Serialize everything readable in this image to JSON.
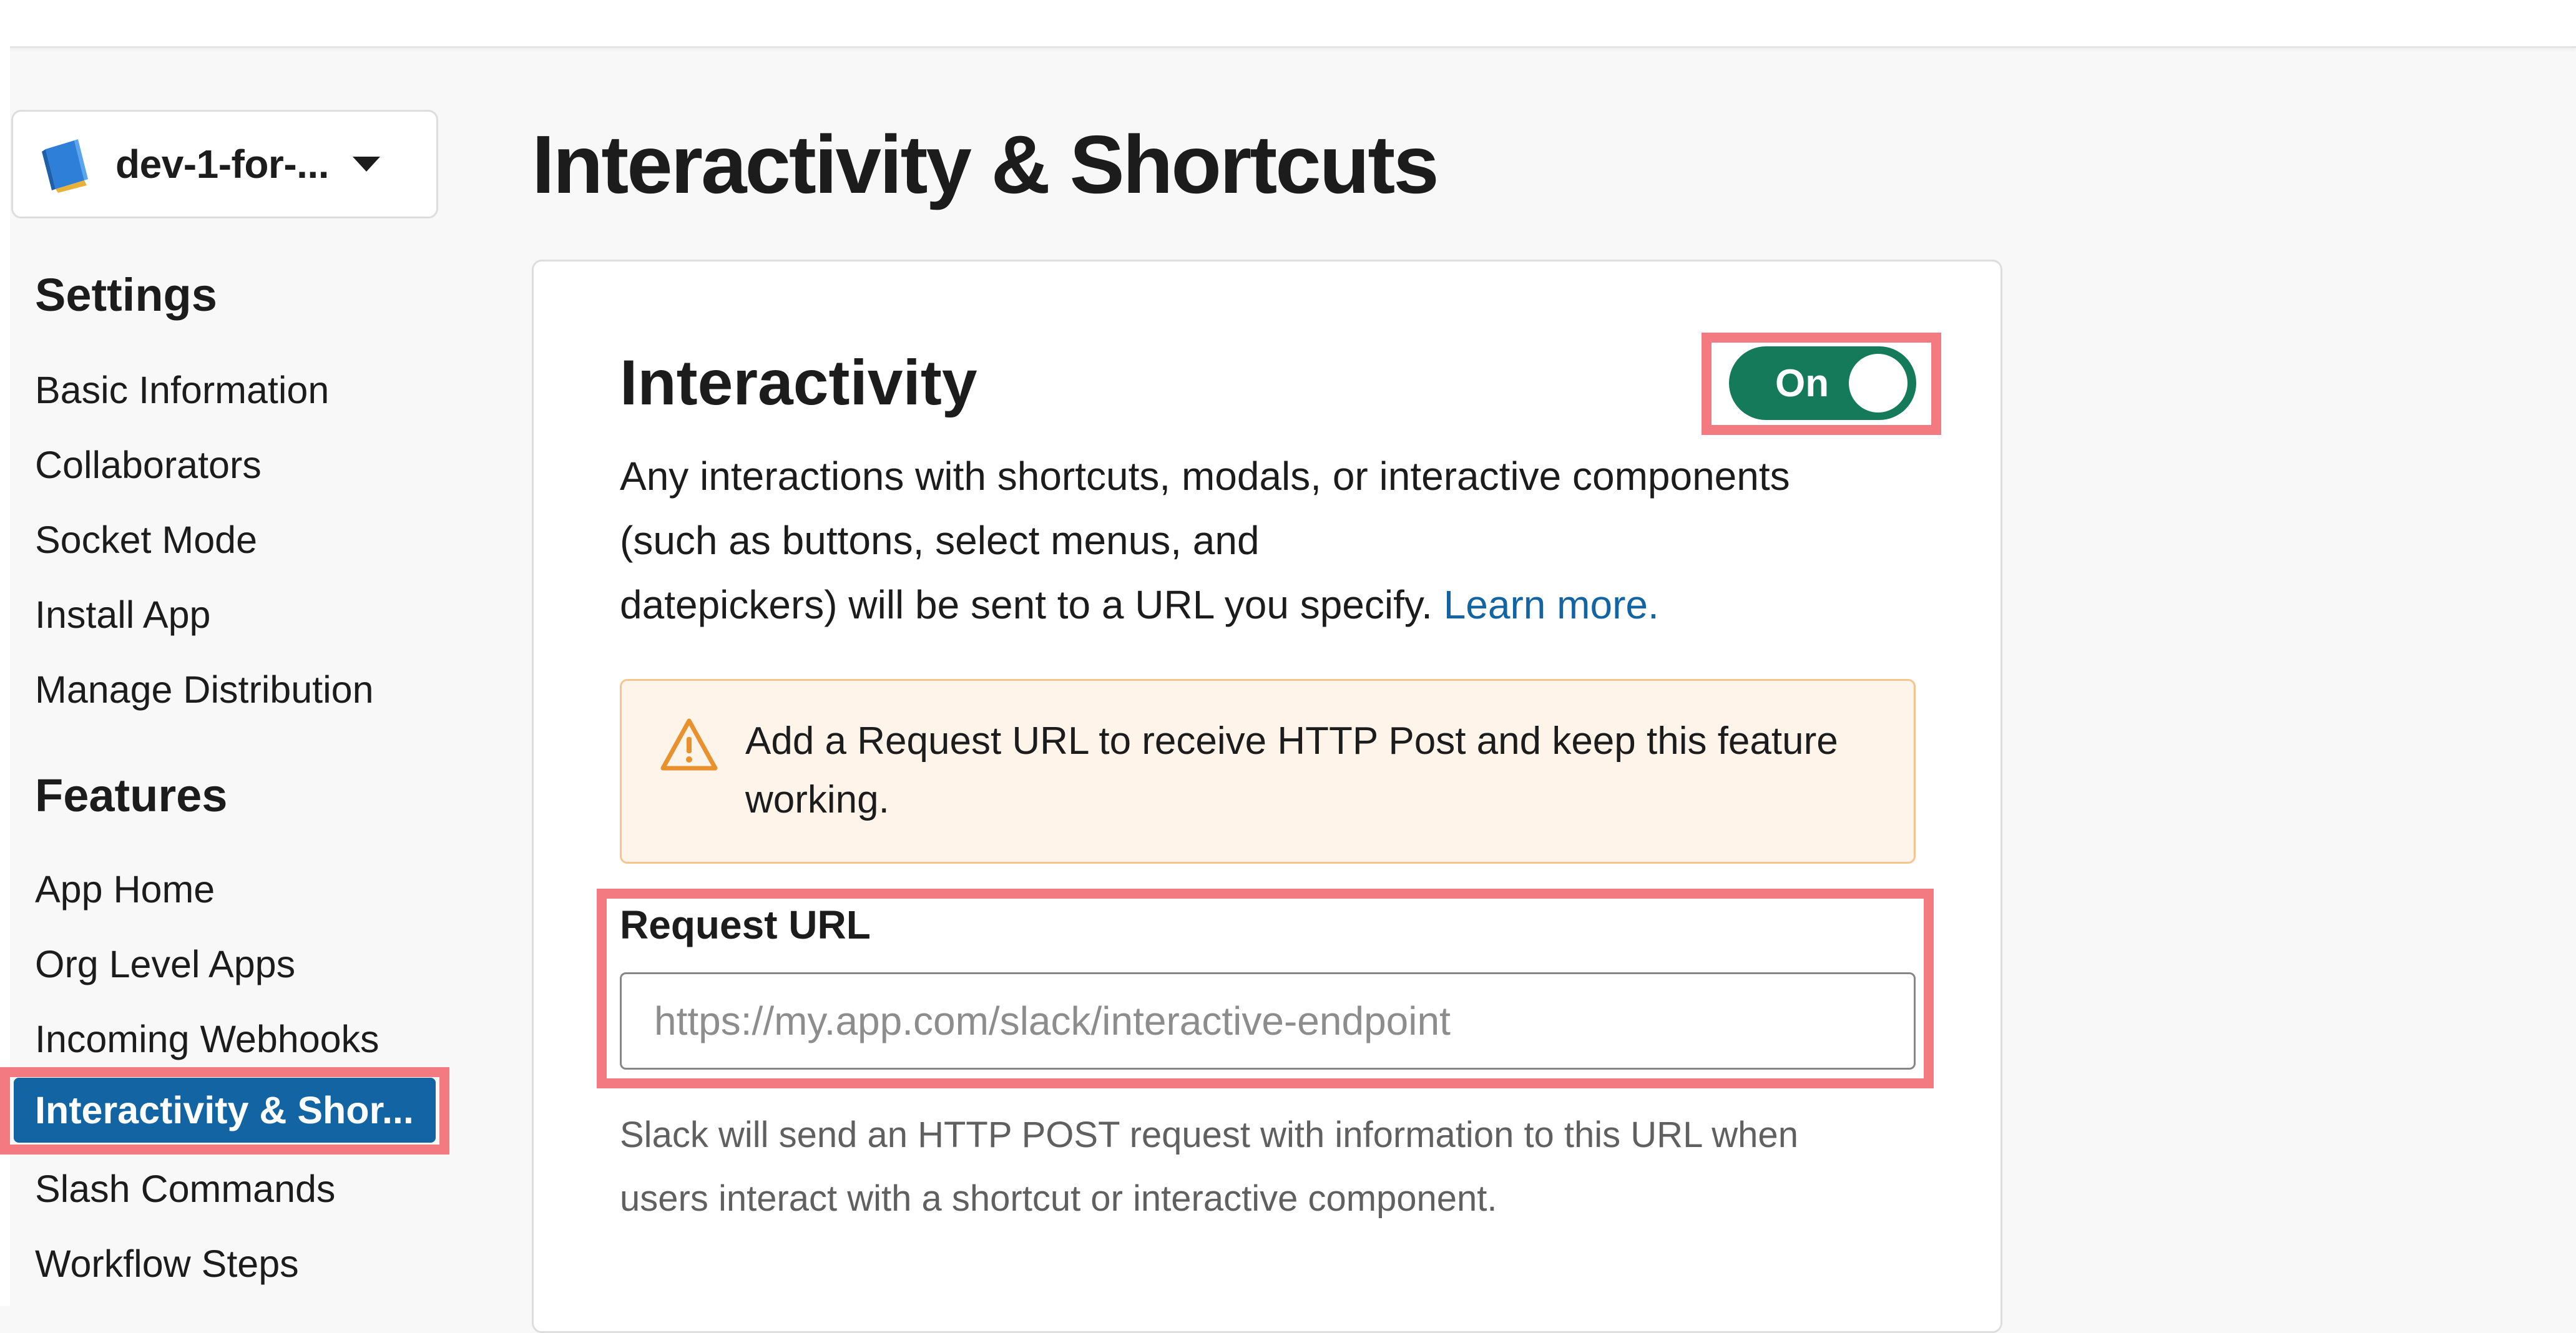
{
  "app_switcher": {
    "name": "dev-1-for-...",
    "icon": "book-icon"
  },
  "sidebar": {
    "settings_heading": "Settings",
    "settings_items": [
      {
        "label": "Basic Information"
      },
      {
        "label": "Collaborators"
      },
      {
        "label": "Socket Mode"
      },
      {
        "label": "Install App"
      },
      {
        "label": "Manage Distribution"
      }
    ],
    "features_heading": "Features",
    "features_items": [
      {
        "label": "App Home"
      },
      {
        "label": "Org Level Apps"
      },
      {
        "label": "Incoming Webhooks"
      },
      {
        "label": "Interactivity & Shor...",
        "active": true
      },
      {
        "label": "Slash Commands"
      },
      {
        "label": "Workflow Steps"
      }
    ]
  },
  "main": {
    "page_title": "Interactivity & Shortcuts",
    "section": {
      "title": "Interactivity",
      "toggle_label": "On",
      "toggle_state": "on",
      "description_lines": [
        "Any interactions with shortcuts, modals, or interactive components",
        "(such as buttons, select menus, and",
        "datepickers) will be sent to a URL you specify."
      ],
      "learn_more": "Learn more.",
      "warning_icon": "warning-triangle-icon",
      "warning_text": "Add a Request URL to receive HTTP Post and keep this feature working.",
      "request_url_label": "Request URL",
      "request_url_value": "",
      "request_url_placeholder": "https://my.app.com/slack/interactive-endpoint",
      "help_lines": [
        "Slack will send an HTTP POST request with information to this URL when",
        "users interact with a shortcut or interactive component."
      ]
    }
  },
  "colors": {
    "accent_blue": "#1264a3",
    "toggle_green": "#157a5a",
    "highlight": "#f37a80",
    "warning_orange": "#e8912d"
  }
}
